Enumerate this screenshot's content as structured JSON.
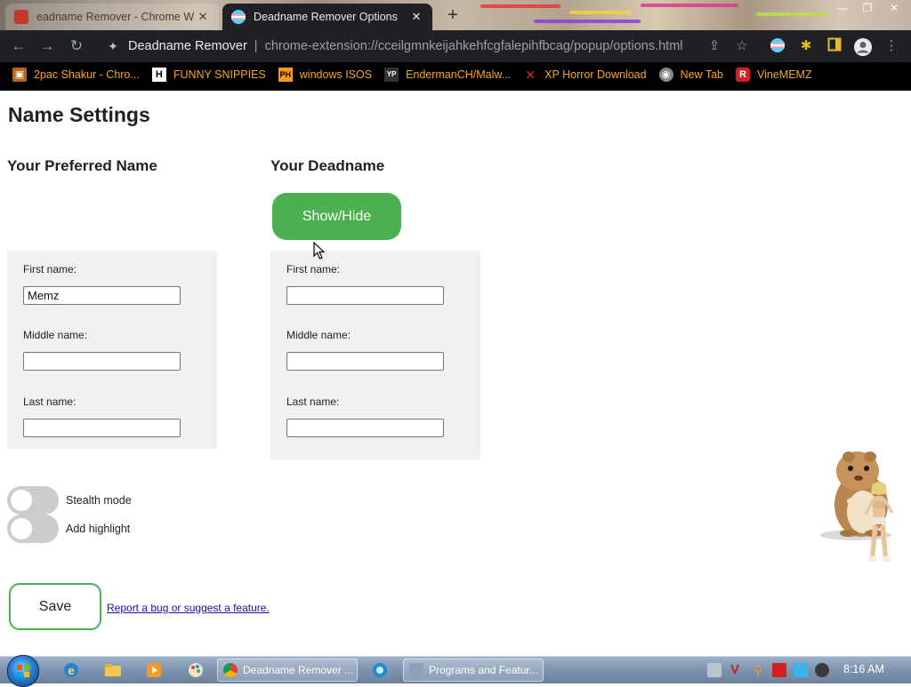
{
  "browser": {
    "tabs": [
      {
        "title": "eadname Remover - Chrome W",
        "active": false
      },
      {
        "title": "Deadname Remover Options",
        "active": true
      }
    ],
    "omnibox": {
      "site_label": "Deadname Remover",
      "url": "chrome-extension://cceilgmnkeijahkehfcgfalepihfbcag/popup/options.html"
    },
    "bookmarks": [
      {
        "label": "2pac Shakur - Chro...",
        "icon": "printer-icon"
      },
      {
        "label": "FUNNY SNIPPIES",
        "icon": "h-icon"
      },
      {
        "label": "windows ISOS",
        "icon": "ph-icon"
      },
      {
        "label": "EndermanCH/Malw...",
        "icon": "yp-icon"
      },
      {
        "label": "XP Horror Download",
        "icon": "x-icon"
      },
      {
        "label": "New Tab",
        "icon": "globe-icon"
      },
      {
        "label": "VineMEMZ",
        "icon": "r-icon"
      }
    ]
  },
  "page": {
    "title": "Name Settings",
    "preferred": {
      "heading": "Your Preferred Name",
      "first_label": "First name:",
      "first_value": "Memz",
      "middle_label": "Middle name:",
      "middle_value": "",
      "last_label": "Last name:",
      "last_value": ""
    },
    "deadname": {
      "heading": "Your Deadname",
      "toggle_button": "Show/Hide",
      "first_label": "First name:",
      "first_value": "",
      "middle_label": "Middle name:",
      "middle_value": "",
      "last_label": "Last name:",
      "last_value": ""
    },
    "stealth_label": "Stealth mode",
    "stealth_on": false,
    "highlight_label": "Add highlight",
    "highlight_on": false,
    "save_label": "Save",
    "report_link": "Report a bug or suggest a feature."
  },
  "taskbar": {
    "tasks": [
      {
        "label": "Deadname Remover ...",
        "icon": "chrome-icon"
      },
      {
        "label": "Programs and Featur...",
        "icon": "control-panel-icon"
      }
    ],
    "clock": "8:16 AM"
  },
  "colors": {
    "accent_green": "#4caf50",
    "bookmark_text": "#f5a623",
    "chrome_dark": "#202124",
    "box_bg": "#f1f1f1"
  }
}
